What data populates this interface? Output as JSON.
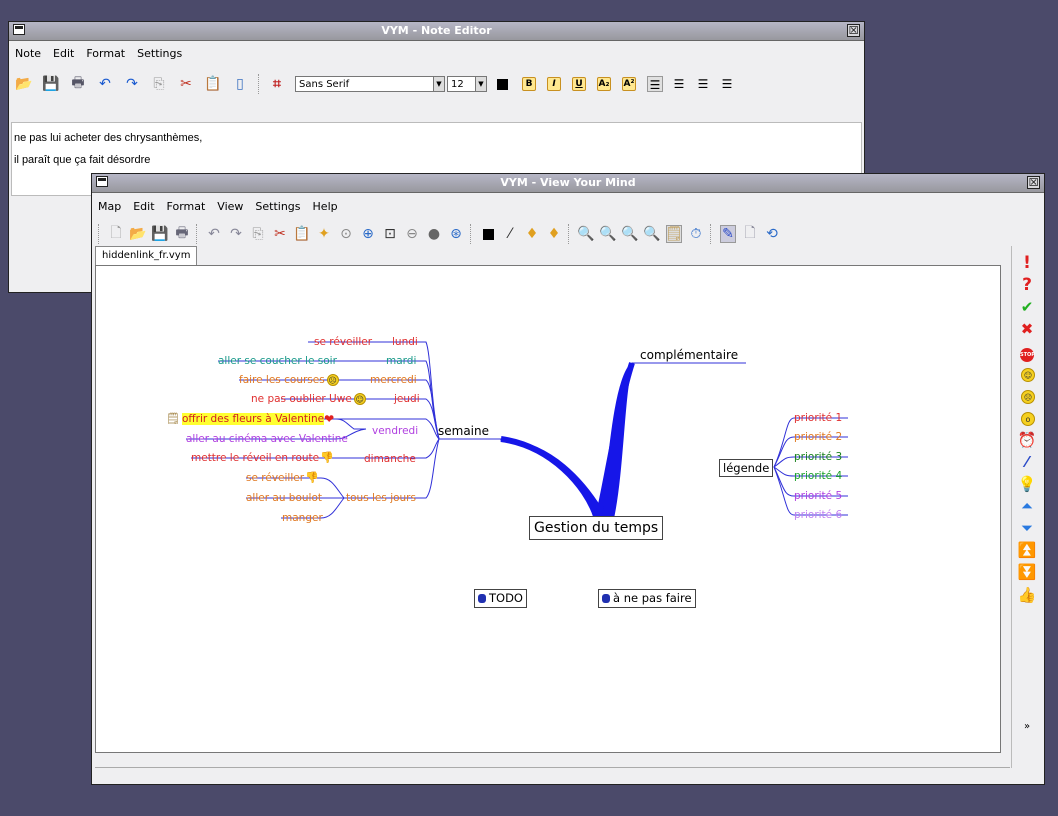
{
  "note_editor": {
    "title": "VYM - Note Editor",
    "close": "☒",
    "menu": [
      "Note",
      "Edit",
      "Format",
      "Settings"
    ],
    "font": "Sans Serif",
    "size": "12",
    "format_buttons": [
      "B",
      "I",
      "U",
      "A₂",
      "A²"
    ],
    "lines": [
      "ne pas lui acheter des chrysanthèmes,",
      "il paraît que ça fait désordre"
    ]
  },
  "main": {
    "title": "VYM - View Your Mind",
    "close": "☒",
    "menu": [
      "Map",
      "Edit",
      "Format",
      "View",
      "Settings",
      "Help"
    ],
    "tab": "hiddenlink_fr.vym"
  },
  "map": {
    "root": "Gestion du temps",
    "branch_semaine": "semaine",
    "branch_compl": "complémentaire",
    "legende": "légende",
    "todo": "TODO",
    "ne_pas_faire": "à ne pas faire",
    "days": {
      "lundi": "lundi",
      "mardi": "mardi",
      "mercredi": "mercredi",
      "jeudi": "jeudi",
      "vendredi": "vendredi",
      "dimanche": "dimanche",
      "tous": "tous les jours"
    },
    "tasks": {
      "reveiller": "se réveiller",
      "coucher": "aller se coucher le soir",
      "courses": "faire les courses",
      "uwe": "ne pas oublier Uwe",
      "fleurs": "offrir des fleurs à Valentine",
      "cinema": "aller au cinéma avec Valentine",
      "reveil": "mettre le réveil en route",
      "reveiller2": "se réveiller",
      "boulot": "aller au boulot",
      "manger": "manger"
    },
    "priorities": [
      "priorité 1",
      "priorité 2",
      "priorité 3",
      "priorité 4",
      "priorité 5",
      "priorité 6"
    ]
  },
  "colors": {
    "branch": "#1a1aee",
    "red": "#e03030",
    "teal": "#1a9a8a",
    "orange": "#e07820",
    "violet": "#b040e0",
    "green": "#18a028",
    "highlight": "#ffff30"
  }
}
